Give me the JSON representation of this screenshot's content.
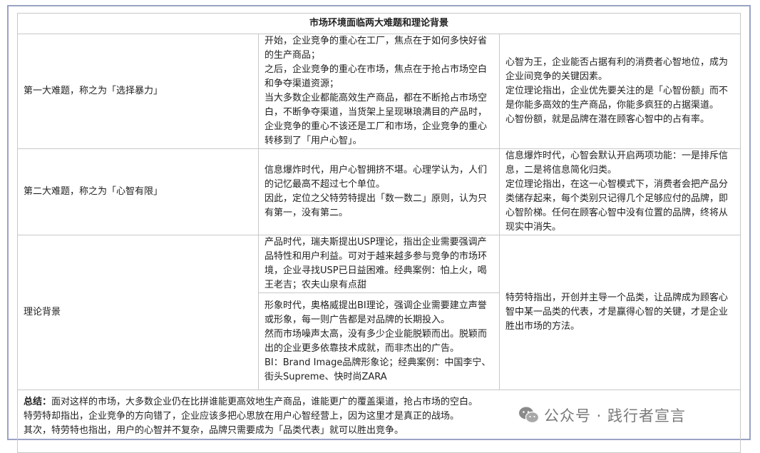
{
  "table": {
    "title": "市场环境面临两大难题和理论背景",
    "row1": {
      "header": "第一大难题，称之为「选择暴力」",
      "middle": [
        "开始，企业竞争的重心在工厂，焦点在于如何多快好省的生产商品；",
        "之后，企业竞争的重心在市场，焦点在于抢占市场空白和争夺渠道资源；",
        "当大多数企业都能高效生产商品，都在不断抢占市场空白，不断争夺渠道，当货架上呈现琳琅满目的产品时，企业竞争的重心不该还是工厂和市场，企业竞争的重心转移到了「用户心智」。"
      ],
      "right": [
        "心智为王，企业能否占据有利的消费者心智地位，成为企业间竞争的关键因素。",
        "定位理论指出，企业优先要关注的是「心智份额」而不是你能多高效的生产商品，你能多疯狂的占据渠道。",
        "心智份额，就是品牌在潜在顾客心智中的占有率。"
      ]
    },
    "row2": {
      "header": "第二大难题，称之为「心智有限」",
      "middle": [
        "信息爆炸时代，用户心智拥挤不堪。心理学认为，人们的记忆最高不超过七个单位。",
        "因此，定位之父特劳特提出「数一数二」原则，认为只有第一，没有第二。"
      ],
      "right": [
        "信息爆炸时代，心智会默认开启两项功能：一是排斥信息，二是将信息简化归类。",
        "定位理论指出，在这一心智模式下，消费者会把产品分类储存起来，每个类别只记得几个足够应付的品牌，即心智阶梯。任何在顾客心智中没有位置的品牌，终将从现实中消失。"
      ]
    },
    "row3": {
      "header": "理论背景",
      "middle_a": "产品时代，瑞夫斯提出USP理论，指出企业需要强调产品特性和用户利益。可对于越来越多参与竞争的市场环境，企业寻找USP已日益困难。经典案例：怕上火，喝王老吉；农夫山泉有点甜",
      "middle_b": [
        "形象时代，奥格威提出BI理论，强调企业需要建立声誉或形象，每一则广告都是对品牌的长期投入。",
        "然而市场噪声太高，没有多少企业能脱颖而出。脱颖而出的企业更多依靠技术成就，而非杰出的广告。",
        "BI：Brand Image品牌形象论；经典案例：中国李宁、街头Supreme、快时尚ZARA"
      ],
      "right": "特劳特指出，开创并主导一个品类，让品牌成为顾客心智中某一品类的代表，才是赢得心智的关键，才是企业胜出市场的方法。"
    },
    "summary": {
      "label": "总结：",
      "line1": "面对这样的市场，大多数企业仍在比拼谁能更高效地生产商品，谁能更广的覆盖渠道，抢占市场的空白。",
      "line2": "特劳特却指出，企业竞争的方向错了，企业应该多把心思放在用户心智经营上，因为这里才是真正的战场。",
      "line3": "其次，特劳特也指出，用户的心智并不复杂，品牌只需要成为「品类代表」就可以胜出竞争。"
    }
  },
  "watermark": {
    "icon": "wechat-icon",
    "text": "公众号 · 践行者宣言"
  }
}
